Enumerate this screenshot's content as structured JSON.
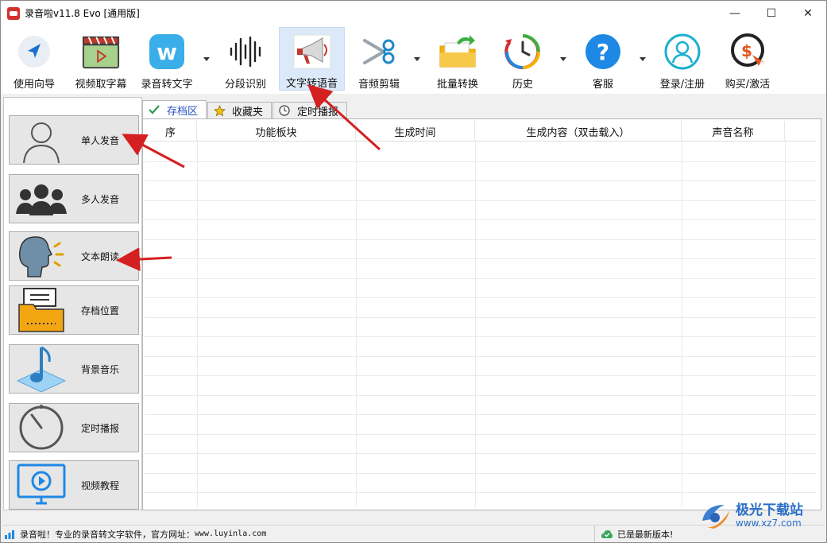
{
  "window": {
    "title": "录音啦v11.8 Evo [通用版]",
    "minimize_glyph": "—",
    "maximize_glyph": "☐",
    "close_glyph": "✕"
  },
  "toolbar": {
    "items": [
      {
        "label": "使用向导",
        "icon": "navigation-arrow-icon"
      },
      {
        "label": "视频取字幕",
        "icon": "film-clapper-icon"
      },
      {
        "label": "录音转文字",
        "icon": "w-app-icon"
      },
      {
        "label": "分段识别",
        "icon": "sound-wave-icon"
      },
      {
        "label": "文字转语音",
        "icon": "megaphone-icon"
      },
      {
        "label": "音频剪辑",
        "icon": "scissors-icon"
      },
      {
        "label": "批量转换",
        "icon": "folder-arrow-icon"
      },
      {
        "label": "历史",
        "icon": "history-clock-icon"
      },
      {
        "label": "客服",
        "icon": "help-question-icon"
      },
      {
        "label": "登录/注册",
        "icon": "user-login-icon"
      },
      {
        "label": "购买/激活",
        "icon": "purchase-coin-icon"
      }
    ],
    "active": "文字转语音"
  },
  "sidebar": {
    "items": [
      {
        "label": "单人发音",
        "icon": "single-person-icon"
      },
      {
        "label": "多人发音",
        "icon": "multiple-people-icon"
      },
      {
        "label": "文本朗读",
        "icon": "speaking-head-icon"
      },
      {
        "label": "存档位置",
        "icon": "archive-folder-icon"
      },
      {
        "label": "背景音乐",
        "icon": "music-note-icon"
      },
      {
        "label": "定时播报",
        "icon": "timer-icon"
      },
      {
        "label": "视频教程",
        "icon": "video-play-icon"
      }
    ]
  },
  "tabs": [
    {
      "label": "存档区",
      "icon": "checkmark-icon",
      "active": true
    },
    {
      "label": "收藏夹",
      "icon": "star-icon",
      "active": false
    },
    {
      "label": "定时播报",
      "icon": "clock-icon",
      "active": false
    }
  ],
  "table": {
    "columns": [
      "序",
      "功能板块",
      "生成时间",
      "生成内容（双击载入）",
      "声音名称"
    ],
    "rows": []
  },
  "status": {
    "left_text": "录音啦！专业的录音转文字软件，官方网址：",
    "url": "www.luyinla.com",
    "right_text": "已是最新版本!"
  },
  "watermark": {
    "title": "极光下载站",
    "subtitle": "www.xz7.com"
  },
  "colors": {
    "accent": "#2a52be",
    "annotation_arrow": "#d42020",
    "active_tool_bg": "#dbe9f8"
  }
}
